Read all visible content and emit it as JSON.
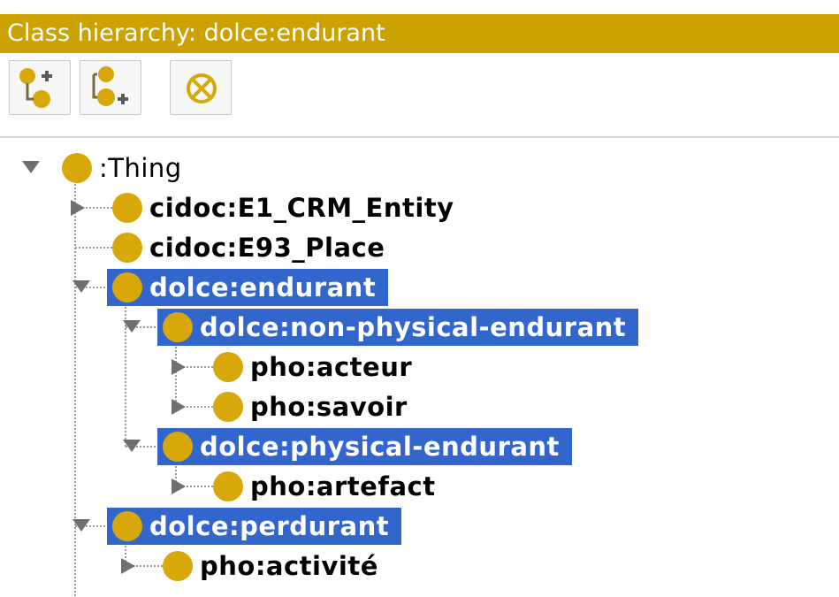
{
  "panel": {
    "title": "Class hierarchy: dolce:endurant"
  },
  "toolbar": {
    "buttons": [
      {
        "name": "add-subclass",
        "icon": "add-subclass-icon"
      },
      {
        "name": "add-sibling",
        "icon": "add-sibling-class-icon"
      },
      {
        "name": "delete-class",
        "icon": "delete-class-icon"
      }
    ]
  },
  "colors": {
    "accent": "#cca200",
    "class_dot": "#d8a80a",
    "selection": "#3366cc"
  },
  "tree": {
    "nodes": [
      {
        "label": ":Thing",
        "depth": 0,
        "toggle": "expanded",
        "selected": false
      },
      {
        "label": "cidoc:E1_CRM_Entity",
        "depth": 1,
        "toggle": "collapsed",
        "selected": false
      },
      {
        "label": "cidoc:E93_Place",
        "depth": 1,
        "toggle": "none",
        "selected": false
      },
      {
        "label": "dolce:endurant",
        "depth": 1,
        "toggle": "expanded",
        "selected": true
      },
      {
        "label": "dolce:non-physical-endurant",
        "depth": 2,
        "toggle": "expanded",
        "selected": true
      },
      {
        "label": "pho:acteur",
        "depth": 3,
        "toggle": "collapsed",
        "selected": false
      },
      {
        "label": "pho:savoir",
        "depth": 3,
        "toggle": "collapsed",
        "selected": false
      },
      {
        "label": "dolce:physical-endurant",
        "depth": 2,
        "toggle": "expanded",
        "selected": true
      },
      {
        "label": "pho:artefact",
        "depth": 3,
        "toggle": "collapsed",
        "selected": false
      },
      {
        "label": "dolce:perdurant",
        "depth": 1,
        "toggle": "expanded",
        "selected": true
      },
      {
        "label": "pho:activité",
        "depth": 2,
        "toggle": "collapsed",
        "selected": false
      }
    ]
  }
}
